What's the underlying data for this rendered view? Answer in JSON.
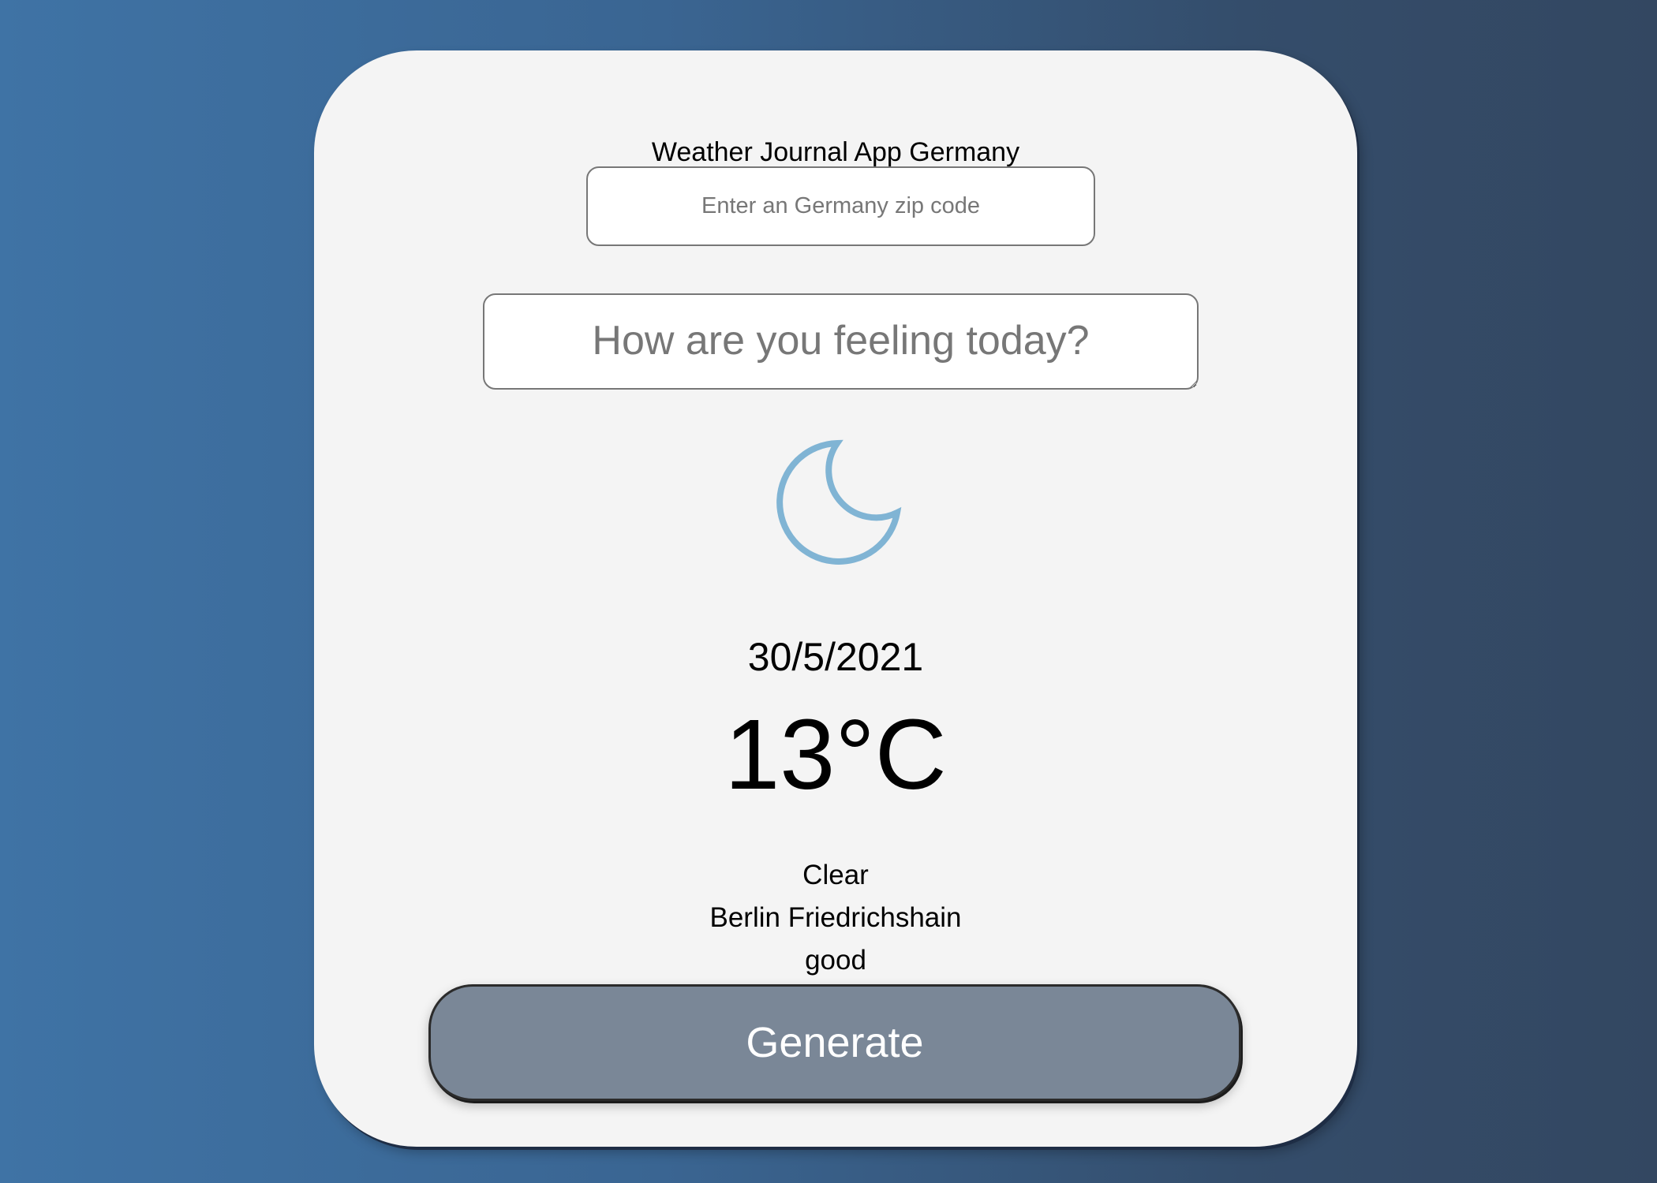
{
  "app": {
    "title": "Weather Journal App Germany"
  },
  "form": {
    "zip_placeholder": "Enter an Germany zip code",
    "zip_value": "",
    "feelings_placeholder": "How are you feeling today?",
    "feelings_value": ""
  },
  "weather": {
    "icon": "moon-icon",
    "icon_color": "#80b4d4",
    "date": "30/5/2021",
    "temperature": "13°C",
    "description": "Clear",
    "location": "Berlin Friedrichshain",
    "feeling": "good"
  },
  "actions": {
    "generate_label": "Generate"
  },
  "colors": {
    "card_background": "#f4f4f4",
    "button_background": "#7a8797",
    "background_gradient_start": "#3f73a5",
    "background_gradient_end": "#334761"
  }
}
